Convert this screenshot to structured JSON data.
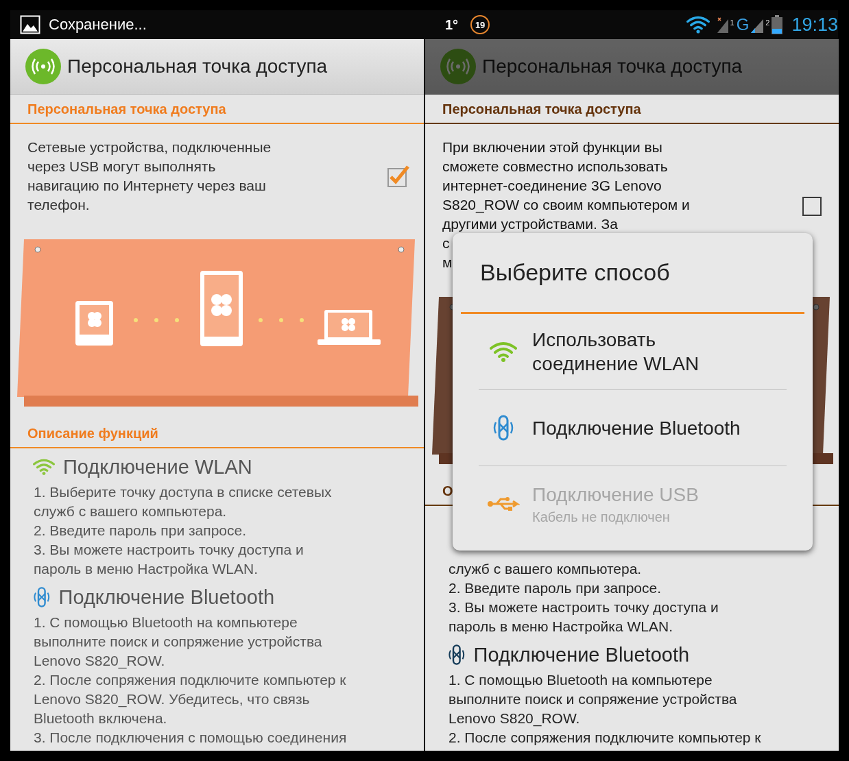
{
  "status_bar": {
    "notification_title": "Сохранение...",
    "indicator": "1°",
    "badge": "19",
    "sim_1": "1",
    "network": "G",
    "sim_2": "2",
    "time": "19:13"
  },
  "panels": [
    {
      "header_title": "Персональная точка доступа",
      "section_title": "Персональная точка доступа",
      "description": [
        "Сетевые устройства, подключенные",
        "через USB могут выполнять",
        "навигацию по Интернету через ваш",
        "телефон."
      ],
      "checked": true,
      "dimmed": false,
      "features_title": "Описание функций",
      "features": [
        {
          "kind": "wlan",
          "title": "Подключение WLAN",
          "steps": [
            "1. Выберите точку доступа в списке сетевых",
            "служб с вашего компьютера.",
            "2. Введите пароль при запросе.",
            "3. Вы можете настроить точку доступа и",
            "пароль в меню Настройка WLAN."
          ]
        },
        {
          "kind": "bluetooth",
          "title": "Подключение Bluetooth",
          "steps": [
            "1. С помощью Bluetooth на компьютере",
            "выполните поиск и сопряжение устройства",
            "Lenovo S820_ROW.",
            "2. После сопряжения подключите компьютер к",
            "Lenovo S820_ROW. Убедитесь, что связь",
            "Bluetooth включена.",
            "3. После подключения с помощью соединения"
          ]
        }
      ]
    },
    {
      "header_title": "Персональная точка доступа",
      "section_title": "Персональная точка доступа",
      "description": [
        "При включении этой функции вы",
        "сможете совместно использовать",
        "интернет-соединение 3G Lenovo",
        "S820_ROW со своим компьютером и",
        "другими устройствами. За",
        "с",
        "м"
      ],
      "checked": false,
      "dimmed": true,
      "features_title": "О",
      "features": [
        {
          "steps": [
            "служб с вашего компьютера.",
            "2. Введите пароль при запросе.",
            "3. Вы можете настроить точку доступа и",
            "пароль в меню Настройка WLAN."
          ]
        },
        {
          "kind": "bluetooth",
          "title": "Подключение Bluetooth",
          "steps": [
            "1. С помощью Bluetooth на компьютере",
            "выполните поиск и сопряжение устройства",
            "Lenovo S820_ROW.",
            "2. После сопряжения подключите компьютер к"
          ]
        }
      ]
    }
  ],
  "dialog": {
    "title": "Выберите способ",
    "options": [
      {
        "kind": "wlan",
        "lines": [
          "Использовать",
          "соединение WLAN"
        ],
        "disabled": false
      },
      {
        "kind": "bluetooth",
        "lines": [
          "Подключение Bluetooth"
        ],
        "disabled": false
      },
      {
        "kind": "usb",
        "lines": [
          "Подключение USB"
        ],
        "subtitle": "Кабель не подключен",
        "disabled": true
      }
    ]
  }
}
